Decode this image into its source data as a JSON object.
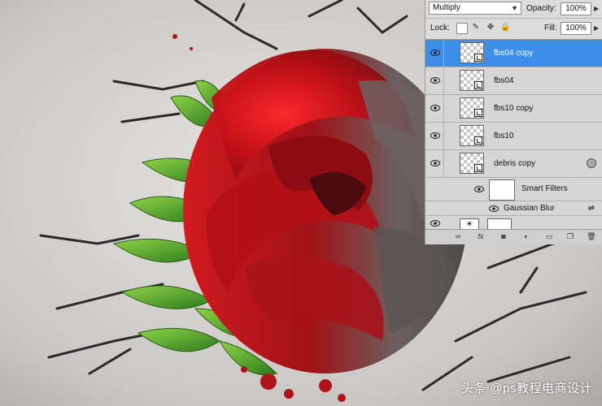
{
  "layers_panel": {
    "blend_mode": "Multiply",
    "opacity_label": "Opacity:",
    "opacity_value": "100%",
    "lock_label": "Lock:",
    "fill_label": "Fill:",
    "fill_value": "100%",
    "layers": [
      {
        "name": "fbs04 copy",
        "selected": true
      },
      {
        "name": "fbs04",
        "selected": false
      },
      {
        "name": "fbs10 copy",
        "selected": false
      },
      {
        "name": "fbs10",
        "selected": false
      },
      {
        "name": "debris copy",
        "selected": false
      }
    ],
    "smart_filters_label": "Smart Filters",
    "gaussian_blur_label": "Gaussian Blur"
  },
  "watermark": "头条 @ps教程电商设计",
  "colors": {
    "selection": "#3d8ee8",
    "rose_red": "#c4121a",
    "leaf_green": "#4f9a2a",
    "background": "#cfcdc9"
  }
}
